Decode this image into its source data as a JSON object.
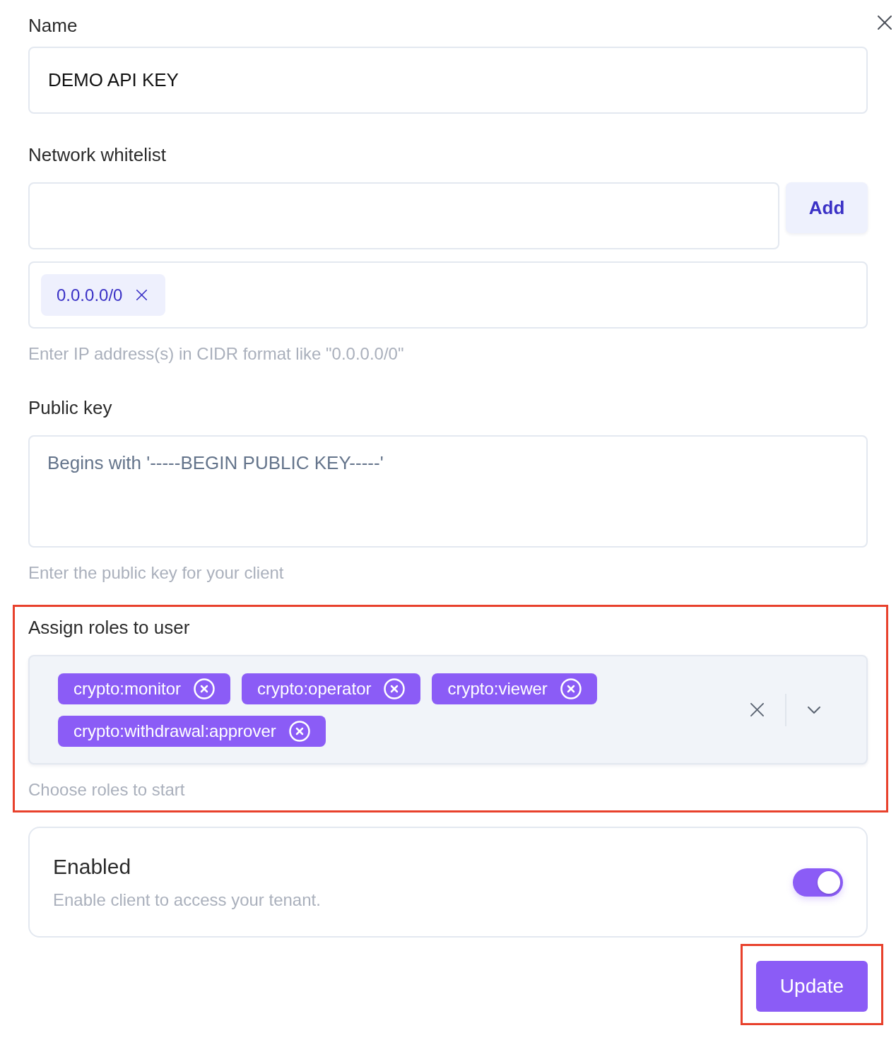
{
  "name": {
    "label": "Name",
    "value": "DEMO API KEY"
  },
  "network_whitelist": {
    "label": "Network whitelist",
    "add_button": "Add",
    "entries": [
      "0.0.0.0/0"
    ],
    "hint": "Enter IP address(s) in CIDR format like \"0.0.0.0/0\""
  },
  "public_key": {
    "label": "Public key",
    "placeholder": "Begins with '-----BEGIN PUBLIC KEY-----'",
    "hint": "Enter the public key for your client"
  },
  "roles": {
    "label": "Assign roles to user",
    "selected_roles": [
      "crypto:monitor",
      "crypto:operator",
      "crypto:viewer",
      "crypto:withdrawal:approver"
    ],
    "hint": "Choose roles to start",
    "highlighted": true
  },
  "enabled": {
    "title": "Enabled",
    "description": "Enable client to access your tenant.",
    "on": true
  },
  "update_button": {
    "label": "Update",
    "highlighted": true
  }
}
